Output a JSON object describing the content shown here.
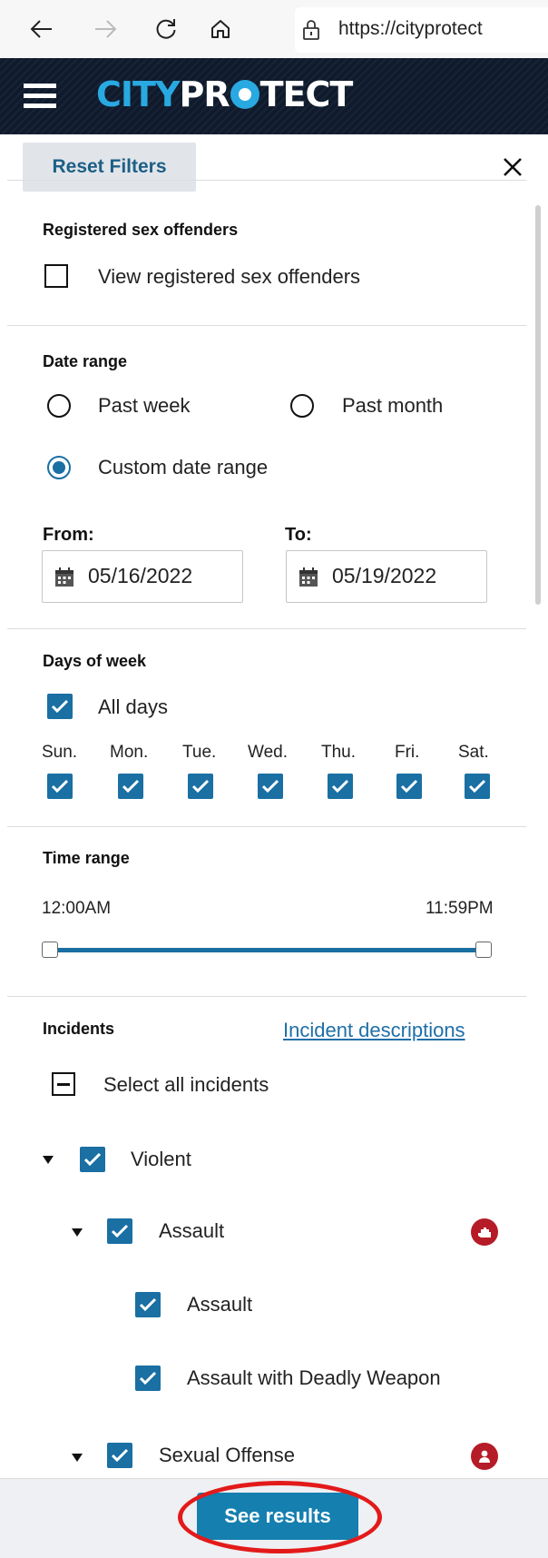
{
  "browser": {
    "url": "https://cityprotect"
  },
  "header": {
    "logo_city": "CITY",
    "logo_pr": "PR",
    "logo_tect": "TECT"
  },
  "filters": {
    "reset_label": "Reset Filters",
    "sex_offenders": {
      "heading": "Registered sex offenders",
      "option": "View registered sex offenders",
      "checked": false
    },
    "date_range": {
      "heading": "Date range",
      "options": [
        "Past week",
        "Past month",
        "Custom date range"
      ],
      "selected": "Custom date range",
      "from_label": "From:",
      "to_label": "To:",
      "from_value": "05/16/2022",
      "to_value": "05/19/2022"
    },
    "days_of_week": {
      "heading": "Days of week",
      "all_label": "All days",
      "days": [
        "Sun.",
        "Mon.",
        "Tue.",
        "Wed.",
        "Thu.",
        "Fri.",
        "Sat."
      ]
    },
    "time_range": {
      "heading": "Time range",
      "start": "12:00AM",
      "end": "11:59PM"
    },
    "incidents": {
      "heading": "Incidents",
      "descriptions_link": "Incident descriptions",
      "select_all": "Select all incidents",
      "violent": "Violent",
      "assault_group": "Assault",
      "assault": "Assault",
      "assault_deadly": "Assault with Deadly Weapon",
      "sexual_offense": "Sexual Offense"
    },
    "see_results": "See results"
  },
  "colors": {
    "accent": "#1a6fa3",
    "header_bg": "#0f1b2d",
    "logo_blue": "#29a9e1",
    "incident_red": "#b51c27",
    "annotation_red": "#e31a1a"
  }
}
